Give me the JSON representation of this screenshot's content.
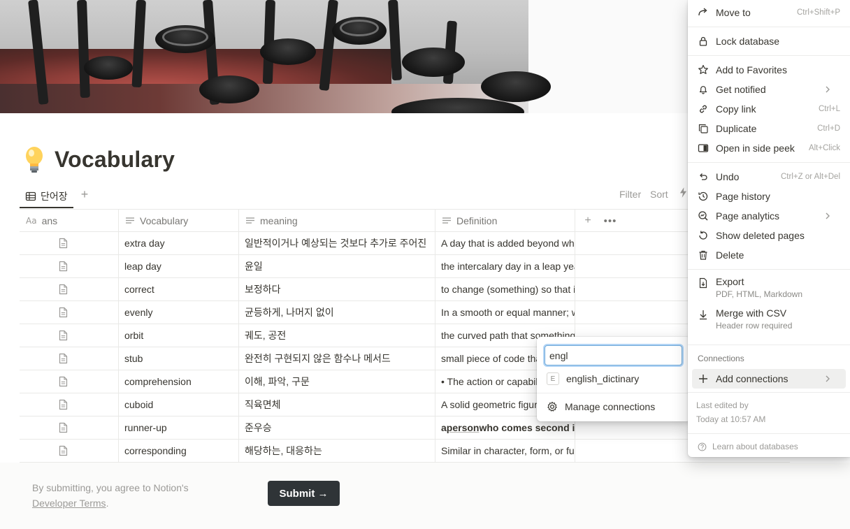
{
  "page": {
    "title": "Vocabulary",
    "icon": "lightbulb-icon"
  },
  "view": {
    "tab_label": "단어장",
    "filter_label": "Filter",
    "sort_label": "Sort"
  },
  "table": {
    "columns": [
      {
        "label": "ans",
        "icon": "title-aa-icon"
      },
      {
        "label": "Vocabulary",
        "icon": "text-lines-icon"
      },
      {
        "label": "meaning",
        "icon": "text-lines-icon"
      },
      {
        "label": "Definition",
        "icon": "text-lines-icon"
      }
    ],
    "rows": [
      {
        "vocab": "extra day",
        "meaning": "일반적이거나 예상되는 것보다 추가로 주어진",
        "definition": "A day that is added beyond what is usual"
      },
      {
        "vocab": "leap day",
        "meaning": "윤일",
        "definition": "the intercalary day in a leap year"
      },
      {
        "vocab": "correct",
        "meaning": "보정하다",
        "definition": "to change (something) so that it is right"
      },
      {
        "vocab": "evenly",
        "meaning": "균등하게, 나머지 없이",
        "definition": "In a smooth or equal manner; without remainder"
      },
      {
        "vocab": "orbit",
        "meaning": "궤도, 공전",
        "definition": "the curved path that something follows"
      },
      {
        "vocab": "stub",
        "meaning": "완전히 구현되지 않은 함수나 메서드",
        "definition": "small piece of code that stands in"
      },
      {
        "vocab": "comprehension",
        "meaning": "이해, 파악, 구문",
        "definition": "• The action or capability of understanding"
      },
      {
        "vocab": "cuboid",
        "meaning": "직육면체",
        "definition": "A solid geometric figure with six faces"
      },
      {
        "vocab": "runner-up",
        "meaning": "준우승",
        "definition_pre": "a ",
        "definition_link": "person",
        "definition_post": " who comes second in a race"
      },
      {
        "vocab": "corresponding",
        "meaning": "해당하는, 대응하는",
        "definition": "Similar in character, form, or function"
      }
    ]
  },
  "footer": {
    "terms_text": "By submitting, you agree to Notion's",
    "terms_link": "Developer Terms",
    "terms_end": ".",
    "submit_label": "Submit →"
  },
  "menu": {
    "move_to": {
      "label": "Move to",
      "shortcut": "Ctrl+Shift+P"
    },
    "lock": {
      "label": "Lock database"
    },
    "favorites": {
      "label": "Add to Favorites"
    },
    "notified": {
      "label": "Get notified"
    },
    "copy_link": {
      "label": "Copy link",
      "shortcut": "Ctrl+L"
    },
    "duplicate": {
      "label": "Duplicate",
      "shortcut": "Ctrl+D"
    },
    "side_peek": {
      "label": "Open in side peek",
      "shortcut": "Alt+Click"
    },
    "undo": {
      "label": "Undo",
      "shortcut": "Ctrl+Z or Alt+Del"
    },
    "history": {
      "label": "Page history"
    },
    "analytics": {
      "label": "Page analytics"
    },
    "deleted": {
      "label": "Show deleted pages"
    },
    "delete": {
      "label": "Delete"
    },
    "export": {
      "label": "Export",
      "sub": "PDF, HTML, Markdown"
    },
    "merge": {
      "label": "Merge with CSV",
      "sub": "Header row required"
    },
    "connections_heading": "Connections",
    "add_connections": {
      "label": "Add connections"
    },
    "last_edited_by": "Last edited by",
    "last_edited_time": "Today at 10:57 AM",
    "learn": "Learn about databases"
  },
  "connections": {
    "search_value": "engl",
    "result_label": "english_dictinary",
    "result_badge": "E",
    "manage_label": "Manage connections"
  }
}
